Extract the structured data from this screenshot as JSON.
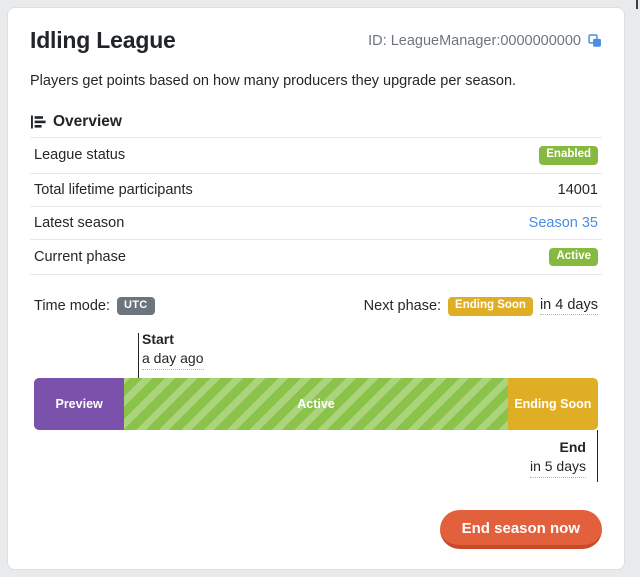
{
  "header": {
    "title": "Idling League",
    "id_label": "ID: LeagueManager:0000000000",
    "copy_icon": "copy-icon",
    "subtitle": "Players get points based on how many producers they upgrade per season."
  },
  "overview": {
    "icon": "bar-list-icon",
    "heading": "Overview",
    "rows": [
      {
        "label": "League status",
        "value": "Enabled",
        "kind": "badge-green"
      },
      {
        "label": "Total lifetime participants",
        "value": "14001",
        "kind": "text"
      },
      {
        "label": "Latest season",
        "value": "Season 35",
        "kind": "link"
      },
      {
        "label": "Current phase",
        "value": "Active",
        "kind": "badge-green"
      }
    ]
  },
  "timemode": {
    "label": "Time mode:",
    "badge": "UTC",
    "next_phase_label": "Next phase:",
    "next_phase_badge": "Ending Soon",
    "next_phase_when": "in 4 days"
  },
  "timeline": {
    "start_name": "Start",
    "start_when": "a day ago",
    "end_name": "End",
    "end_when": "in 5 days",
    "segments": [
      {
        "label": "Preview",
        "kind": "seg-preview",
        "width_pct": 16
      },
      {
        "label": "Active",
        "kind": "seg-active",
        "width_pct": 68
      },
      {
        "label": "Ending Soon",
        "kind": "seg-ending",
        "width_pct": 16
      }
    ]
  },
  "footer": {
    "end_season_label": "End season now"
  },
  "colors": {
    "green": "#86b93f",
    "amber": "#dfae24",
    "purple": "#7b52ab",
    "active_green": "#8bc34a",
    "gray_badge": "#6c757d",
    "link_blue": "#4a8ee0",
    "danger": "#e2603c",
    "danger_shadow": "#c94a28"
  }
}
